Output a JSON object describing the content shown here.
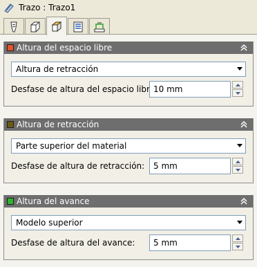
{
  "window": {
    "title": "Trazo : Trazo1"
  },
  "tabs": [
    {
      "name": "tool-tab",
      "icon": "tool-icon"
    },
    {
      "name": "geometry-tab",
      "icon": "cube-outline-icon"
    },
    {
      "name": "heights-tab",
      "icon": "cube-heights-icon",
      "active": true
    },
    {
      "name": "passes-tab",
      "icon": "passes-icon"
    },
    {
      "name": "linking-tab",
      "icon": "linking-icon"
    }
  ],
  "panels": {
    "clearance": {
      "title": "Altura del espacio libre",
      "color": "#e8532a",
      "select_value": "Altura de retracción",
      "offset_label": "Desfase de altura del espacio libre:",
      "offset_value": "10 mm"
    },
    "retract": {
      "title": "Altura de retracción",
      "color": "#6b5a12",
      "select_value": "Parte superior del material",
      "offset_label": "Desfase de altura de retracción:",
      "offset_value": "5 mm"
    },
    "feed": {
      "title": "Altura del avance",
      "color": "#2db52d",
      "select_value": "Modelo superior",
      "offset_label": "Desfase de altura del avance:",
      "offset_value": "5 mm"
    }
  }
}
